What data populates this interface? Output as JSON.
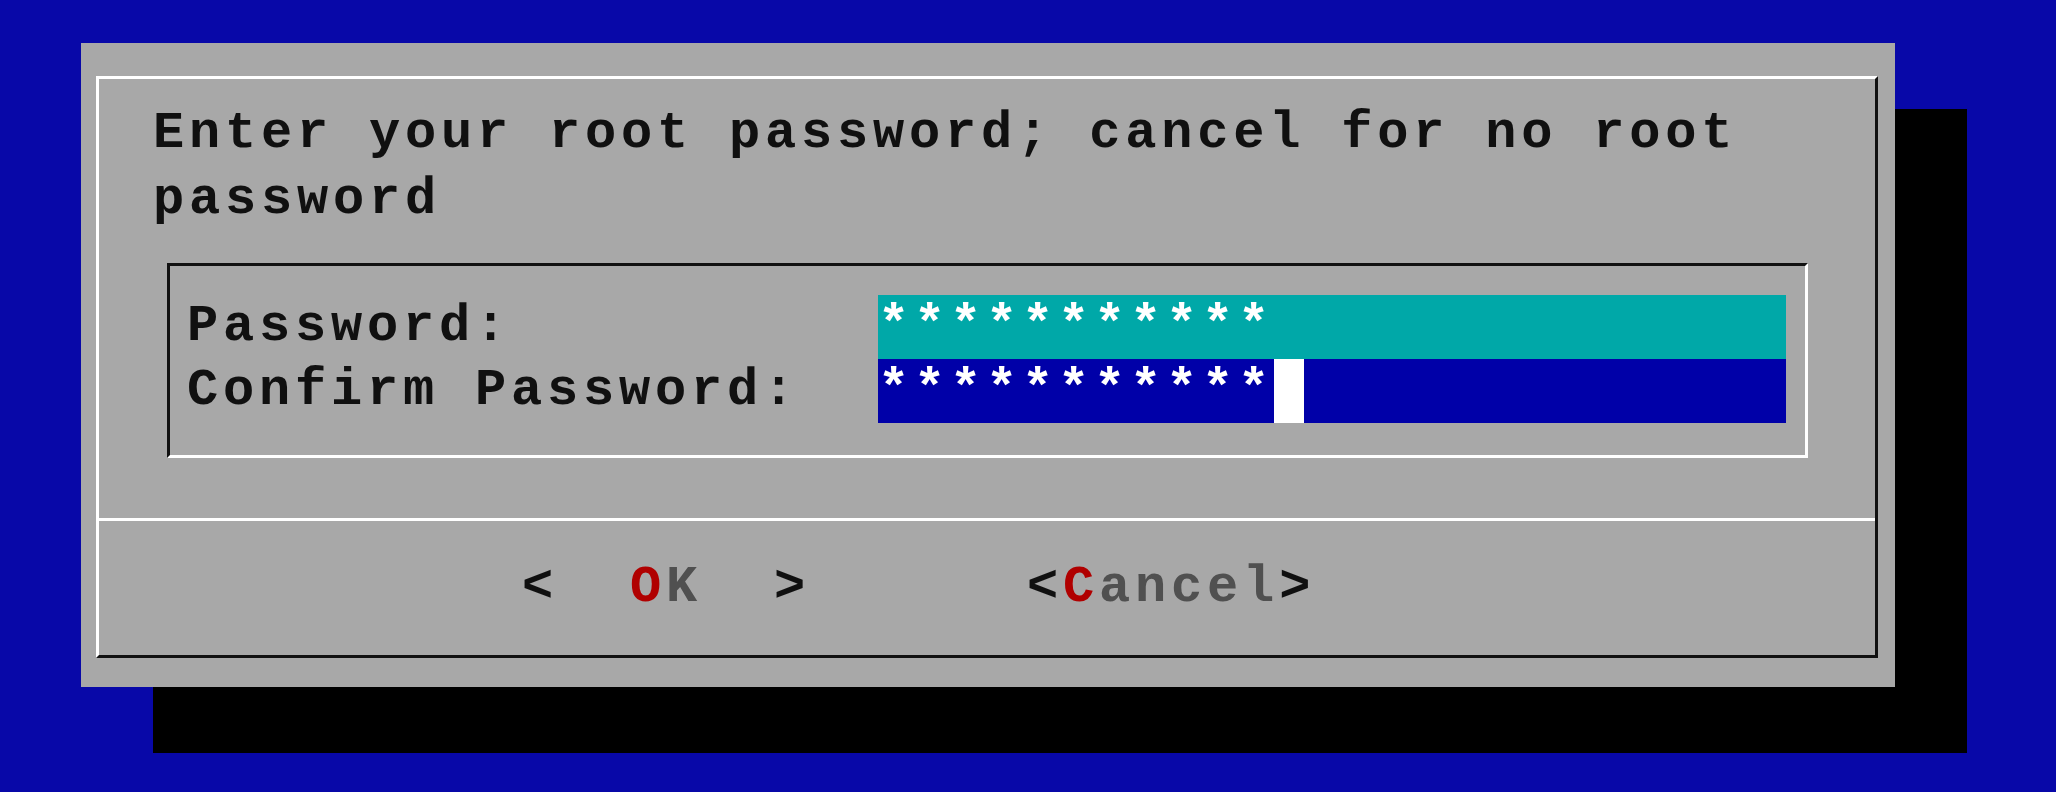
{
  "dialog": {
    "message": "Enter your root password; cancel for no root password",
    "fields": [
      {
        "label": "Password:",
        "value": "***********",
        "highlighted": true,
        "cursor": false
      },
      {
        "label": "Confirm Password:",
        "value": "***********",
        "highlighted": false,
        "cursor": true
      }
    ],
    "buttons": [
      {
        "left": "<  ",
        "hotkey": "O",
        "rest": "K",
        "right": "  >",
        "selected": false
      },
      {
        "left": "<",
        "hotkey": "C",
        "rest": "ancel",
        "right": ">",
        "selected": false
      }
    ]
  }
}
